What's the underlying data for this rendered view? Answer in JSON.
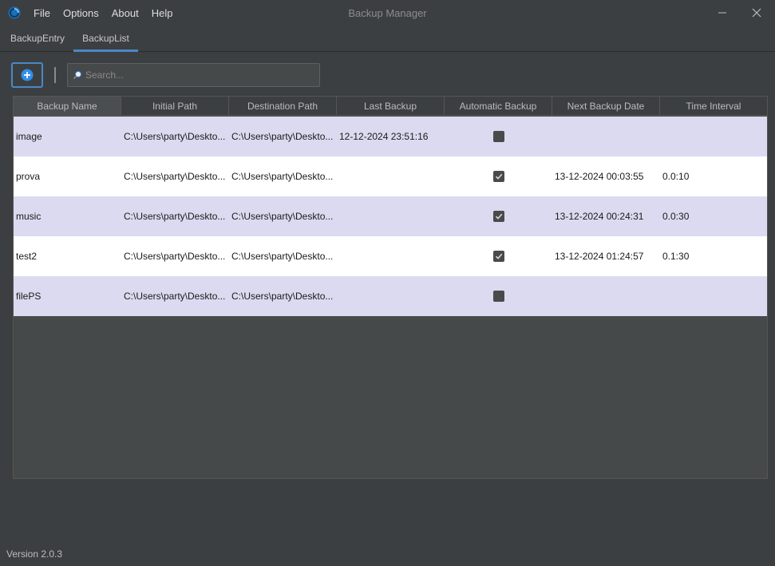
{
  "window": {
    "title": "Backup Manager",
    "menu": [
      "File",
      "Options",
      "About",
      "Help"
    ]
  },
  "tabs": [
    {
      "label": "BackupEntry",
      "active": false
    },
    {
      "label": "BackupList",
      "active": true
    }
  ],
  "toolbar": {
    "add_icon": "plus-circle-icon",
    "search_placeholder": "Search...",
    "search_value": ""
  },
  "table": {
    "columns": [
      "Backup Name",
      "Initial Path",
      "Destination Path",
      "Last Backup",
      "Automatic Backup",
      "Next Backup Date",
      "Time Interval"
    ],
    "rows": [
      {
        "name": "image",
        "initial": "C:\\Users\\party\\Deskto...",
        "dest": "C:\\Users\\party\\Deskto...",
        "last": "12-12-2024 23:51:16",
        "auto": false,
        "next": "",
        "interval": ""
      },
      {
        "name": "prova",
        "initial": "C:\\Users\\party\\Deskto...",
        "dest": "C:\\Users\\party\\Deskto...",
        "last": "",
        "auto": true,
        "next": "13-12-2024 00:03:55",
        "interval": "0.0:10"
      },
      {
        "name": "music",
        "initial": "C:\\Users\\party\\Deskto...",
        "dest": "C:\\Users\\party\\Deskto...",
        "last": "",
        "auto": true,
        "next": "13-12-2024 00:24:31",
        "interval": "0.0:30"
      },
      {
        "name": "test2",
        "initial": "C:\\Users\\party\\Deskto...",
        "dest": "C:\\Users\\party\\Deskto...",
        "last": "",
        "auto": true,
        "next": "13-12-2024 01:24:57",
        "interval": "0.1:30"
      },
      {
        "name": "filePS",
        "initial": "C:\\Users\\party\\Deskto...",
        "dest": "C:\\Users\\party\\Deskto...",
        "last": "",
        "auto": false,
        "next": "",
        "interval": ""
      }
    ]
  },
  "footer": {
    "version": "Version 2.0.3"
  },
  "colors": {
    "background": "#3c3f41",
    "accent": "#4a88c7",
    "row_alt": "#dcdaf0",
    "row": "#ffffff"
  }
}
